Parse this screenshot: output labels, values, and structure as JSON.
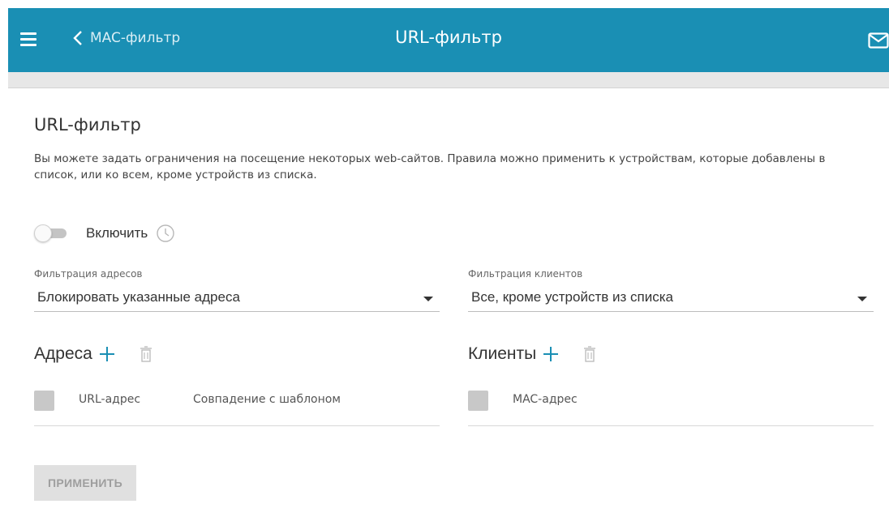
{
  "header": {
    "back_label": "MAC-фильтр",
    "title": "URL-фильтр"
  },
  "page": {
    "title": "URL-фильтр",
    "description": "Вы можете задать ограничения на посещение некоторых web-сайтов. Правила можно применить к устройствам, которые добавлены в список, или ко всем, кроме устройств из списка."
  },
  "enable": {
    "label": "Включить",
    "checked": false
  },
  "address_filter": {
    "label": "Фильтрация адресов",
    "value": "Блокировать указанные адреса"
  },
  "client_filter": {
    "label": "Фильтрация клиентов",
    "value": "Все, кроме устройств из списка"
  },
  "addresses": {
    "title": "Адреса",
    "columns": [
      "URL-адрес",
      "Совпадение с шаблоном"
    ]
  },
  "clients": {
    "title": "Клиенты",
    "columns": [
      "MAC-адрес"
    ]
  },
  "actions": {
    "apply_label": "ПРИМЕНИТЬ"
  },
  "colors": {
    "header_bg": "#1a8fb4",
    "accent": "#1a8fb4",
    "disabled_button": "#e0e0e0"
  },
  "icons": [
    "menu-icon",
    "chevron-left-icon",
    "mail-icon",
    "clock-icon",
    "plus-icon",
    "trash-icon"
  ]
}
